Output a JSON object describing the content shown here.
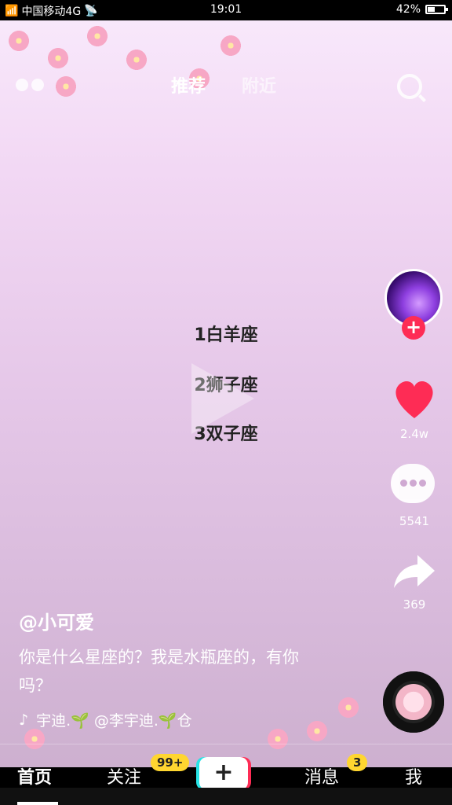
{
  "status": {
    "signal": "4G",
    "carrier": "中国移动4G",
    "time": "19:01",
    "battery": "42%",
    "battery_level": 0.42
  },
  "topnav": {
    "tabs": [
      "推荐",
      "附近"
    ]
  },
  "video": {
    "lines": [
      "1白羊座",
      "2狮子座",
      "3双子座"
    ]
  },
  "actions": {
    "likes": "2.4w",
    "comments": "5541",
    "shares": "369"
  },
  "post": {
    "username": "@小可爱",
    "description": "你是什么星座的？我是水瓶座的，有你吗？",
    "music": "宇迪.🌱  @李宇迪.🌱仓"
  },
  "bottom": {
    "home": "首页",
    "follow": "关注",
    "follow_badge": "99+",
    "plus": "+",
    "messages": "消息",
    "messages_badge": "3",
    "me": "我"
  },
  "colors": {
    "accent": "#fe2c55",
    "badge": "#ffd630"
  }
}
